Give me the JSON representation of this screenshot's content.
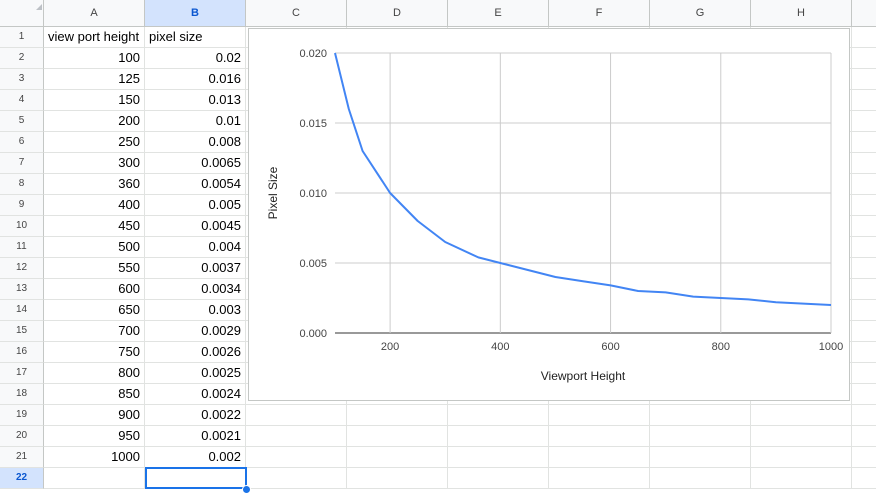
{
  "sheet": {
    "columns": [
      "A",
      "B",
      "C",
      "D",
      "E",
      "F",
      "G",
      "H"
    ],
    "selected_column": "B",
    "row_numbers": [
      "1",
      "2",
      "3",
      "4",
      "5",
      "6",
      "7",
      "8",
      "9",
      "10",
      "11",
      "12",
      "13",
      "14",
      "15",
      "16",
      "17",
      "18",
      "19",
      "20",
      "21",
      "22"
    ],
    "selected_row": "22",
    "headers": [
      "view port height",
      "pixel size"
    ],
    "rows": [
      [
        "100",
        "0.02"
      ],
      [
        "125",
        "0.016"
      ],
      [
        "150",
        "0.013"
      ],
      [
        "200",
        "0.01"
      ],
      [
        "250",
        "0.008"
      ],
      [
        "300",
        "0.0065"
      ],
      [
        "360",
        "0.0054"
      ],
      [
        "400",
        "0.005"
      ],
      [
        "450",
        "0.0045"
      ],
      [
        "500",
        "0.004"
      ],
      [
        "550",
        "0.0037"
      ],
      [
        "600",
        "0.0034"
      ],
      [
        "650",
        "0.003"
      ],
      [
        "700",
        "0.0029"
      ],
      [
        "750",
        "0.0026"
      ],
      [
        "800",
        "0.0025"
      ],
      [
        "850",
        "0.0024"
      ],
      [
        "900",
        "0.0022"
      ],
      [
        "950",
        "0.0021"
      ],
      [
        "1000",
        "0.002"
      ]
    ]
  },
  "chart_data": {
    "type": "line",
    "x": [
      100,
      125,
      150,
      200,
      250,
      300,
      360,
      400,
      450,
      500,
      550,
      600,
      650,
      700,
      750,
      800,
      850,
      900,
      950,
      1000
    ],
    "series": [
      {
        "values": [
          0.02,
          0.016,
          0.013,
          0.01,
          0.008,
          0.0065,
          0.0054,
          0.005,
          0.0045,
          0.004,
          0.0037,
          0.0034,
          0.003,
          0.0029,
          0.0026,
          0.0025,
          0.0024,
          0.0022,
          0.0021,
          0.002
        ],
        "color": "#4285f4"
      }
    ],
    "xlabel": "Viewport Height",
    "ylabel": "Pixel Size",
    "xlim": [
      100,
      1000
    ],
    "ylim": [
      0,
      0.02
    ],
    "xticks": [
      200,
      400,
      600,
      800,
      1000
    ],
    "xtick_labels": [
      "200",
      "400",
      "600",
      "800",
      "1000"
    ],
    "yticks": [
      0,
      0.005,
      0.01,
      0.015,
      0.02
    ],
    "ytick_labels": [
      "0.000",
      "0.005",
      "0.010",
      "0.015",
      "0.020"
    ],
    "grid": true
  }
}
